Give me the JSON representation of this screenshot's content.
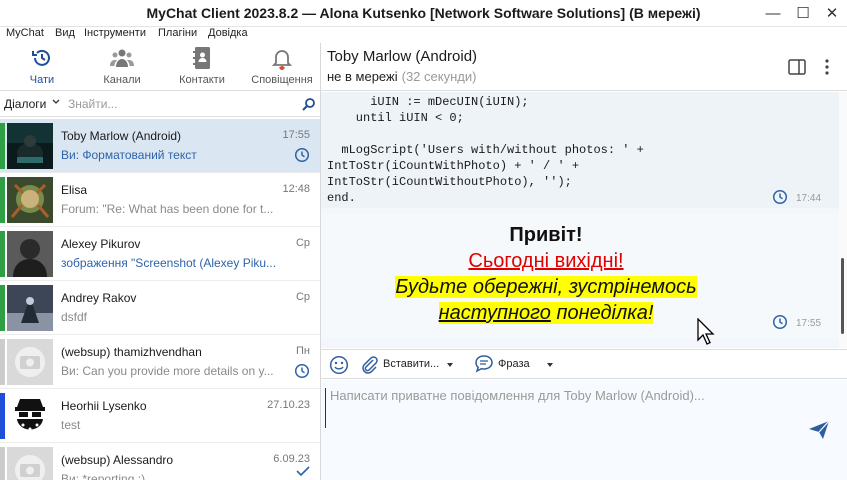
{
  "window": {
    "title": "MyChat Client 2023.8.2 — Alona Kutsenko [Network Software Solutions] (В мережі)",
    "min": "—",
    "max": "☐",
    "close": "✕"
  },
  "menu": [
    "MyChat",
    "Вид",
    "Інструменти",
    "Плагіни",
    "Довідка"
  ],
  "nav_tabs": [
    {
      "label": "Чати",
      "icon": "history-clock-icon",
      "active": true
    },
    {
      "label": "Канали",
      "icon": "group-users-icon",
      "active": false
    },
    {
      "label": "Контакти",
      "icon": "address-book-icon",
      "active": false
    },
    {
      "label": "Сповіщення",
      "icon": "bell-icon",
      "active": false
    }
  ],
  "filter": {
    "label": "Діалоги",
    "placeholder": "Знайти..."
  },
  "dialogs": [
    {
      "name": "Toby Marlow (Android)",
      "preview": "Ви: Форматований текст",
      "time": "17:55",
      "selected": true,
      "strip": "#2ea043",
      "pending": true
    },
    {
      "name": "Elisa",
      "preview": "Forum: \"Re: What has been done for t...",
      "time": "12:48",
      "selected": false,
      "strip": "#2ea043",
      "pending": false
    },
    {
      "name": "Alexey Pikurov",
      "preview": "зображення \"Screenshot (Alexey Piku...",
      "time": "Ср",
      "selected": false,
      "strip": "#2ea043",
      "pending": false
    },
    {
      "name": "Andrey Rakov",
      "preview": "dsfdf",
      "time": "Ср",
      "selected": false,
      "strip": "#2ea043",
      "pending": false
    },
    {
      "name": "(websup) thamizhvendhan",
      "preview": "Ви: Can you provide more details on y...",
      "time": "Пн",
      "selected": false,
      "strip": "#cccccc",
      "pending": true
    },
    {
      "name": "Heorhii Lysenko",
      "preview": "test",
      "time": "27.10.23",
      "selected": false,
      "strip": "#1f4fd8",
      "pending": false
    },
    {
      "name": "(websup) Alessandro",
      "preview": "Ви: *reporting :)",
      "time": "6.09.23",
      "selected": false,
      "strip": "#cccccc",
      "pending": false
    }
  ],
  "chat": {
    "name": "Toby Marlow (Android)",
    "status": "не в мережі",
    "status_ago": "(32 секунди)"
  },
  "messages": {
    "code_lines": [
      "      iUIN := mDecUIN(iUIN);",
      "    until iUIN < 0;",
      "",
      "  mLogScript('Users with/without photos: ' +",
      "IntToStr(iCountWithPhoto) + ' / ' +",
      "IntToStr(iCountWithoutPhoto), '');",
      "end."
    ],
    "code_time": "17:44",
    "greeting_title": "Привіт!",
    "greeting_red": "Сьогодні вихідні!",
    "greeting_line3": "Будьте обережні, зустрінемось",
    "greeting_line4_underlined": "наступного",
    "greeting_line4_rest": "понеділка!",
    "greeting_time": "17:55"
  },
  "composer": {
    "insert_label": "Вставити...",
    "phrase_label": "Фраза",
    "placeholder": "Написати приватне повідомлення для Toby Marlow (Android)..."
  },
  "colors": {
    "accent": "#1f4f9a",
    "selected_row": "#dbe6f3",
    "highlight": "#ffff00",
    "red_text": "#e00000"
  }
}
